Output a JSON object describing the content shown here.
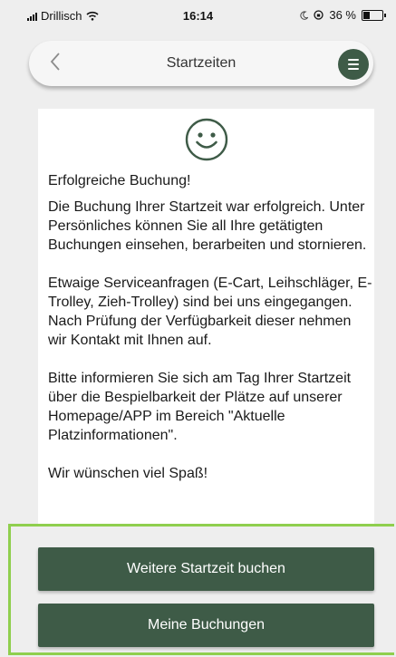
{
  "statusbar": {
    "carrier": "Drillisch",
    "time": "16:14",
    "battery": "36 %",
    "battery_level": 0.36
  },
  "header": {
    "back_icon": "chevron-left-icon",
    "title": "Startzeiten",
    "menu_icon": "hamburger-icon"
  },
  "message": {
    "icon": "smiley-icon",
    "heading": "Erfolgreiche Buchung!",
    "paragraphs": [
      "Die Buchung Ihrer Startzeit war erfolgreich. Unter Persönliches können Sie all Ihre getätigten Buchungen einsehen, berarbeiten und stornieren.",
      "Etwaige Serviceanfragen (E-Cart, Leihschläger, E-Trolley, Zieh-Trolley) sind bei uns eingegangen. Nach Prüfung der Verfügbarkeit dieser nehmen wir Kontakt mit Ihnen auf.",
      "Bitte informieren Sie sich am Tag Ihrer Startzeit über die Bespielbarkeit der Plätze auf unserer Homepage/APP im Bereich \"Aktuelle Platzinformationen\".",
      "Wir wünschen viel Spaß!"
    ]
  },
  "actions": {
    "primary_label": "Weitere Startzeit buchen",
    "secondary_label": "Meine Buchungen"
  },
  "colors": {
    "brand_green": "#3e5b47",
    "highlight": "#8fcf4e",
    "background": "#eeeeee"
  }
}
